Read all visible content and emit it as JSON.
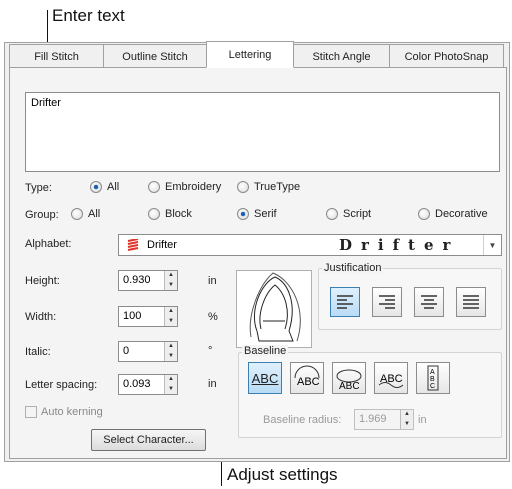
{
  "callouts": {
    "top": "Enter text",
    "bottom": "Adjust settings"
  },
  "tabs": [
    {
      "label": "Fill Stitch"
    },
    {
      "label": "Outline Stitch"
    },
    {
      "label": "Lettering"
    },
    {
      "label": "Stitch Angle"
    },
    {
      "label": "Color PhotoSnap"
    }
  ],
  "text_value": "Drifter",
  "type": {
    "label": "Type:",
    "options": [
      "All",
      "Embroidery",
      "TrueType"
    ],
    "selected": "All"
  },
  "group": {
    "label": "Group:",
    "options": [
      "All",
      "Block",
      "Serif",
      "Script",
      "Decorative"
    ],
    "selected": "Serif"
  },
  "alphabet": {
    "label": "Alphabet:",
    "value": "Drifter",
    "sample": "Drifter"
  },
  "height": {
    "label": "Height:",
    "value": "0.930",
    "unit": "in"
  },
  "width": {
    "label": "Width:",
    "value": "100",
    "unit": "%"
  },
  "italic": {
    "label": "Italic:",
    "value": "0",
    "unit": "°"
  },
  "letter_spacing": {
    "label": "Letter spacing:",
    "value": "0.093",
    "unit": "in"
  },
  "auto_kerning": {
    "label": "Auto kerning",
    "checked": false
  },
  "select_character": "Select Character...",
  "justification": {
    "title": "Justification",
    "options": [
      "left",
      "right",
      "center",
      "full"
    ],
    "selected": "left"
  },
  "baseline": {
    "title": "Baseline",
    "options": [
      "ABC",
      "ABC",
      "ABC",
      "ABC",
      "ABC"
    ],
    "selected_index": 0,
    "radius_label": "Baseline radius:",
    "radius_value": "1.969",
    "radius_unit": "in"
  }
}
